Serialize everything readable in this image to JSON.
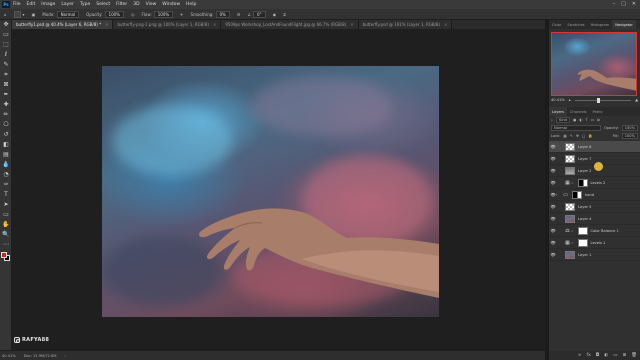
{
  "menu": {
    "logo": "Ps",
    "items": [
      "File",
      "Edit",
      "Image",
      "Layer",
      "Type",
      "Select",
      "Filter",
      "3D",
      "View",
      "Window",
      "Help"
    ],
    "window_controls": [
      "–",
      "□",
      "✕"
    ]
  },
  "options": {
    "mode_label": "Mode:",
    "mode_value": "Normal",
    "opacity_label": "Opacity:",
    "opacity_value": "100%",
    "flow_label": "Flow:",
    "flow_value": "100%",
    "smoothing_label": "Smoothing:",
    "smoothing_value": "0%",
    "angle_value": "0°"
  },
  "tabs": [
    {
      "label": "butterfly1.psd @ 40.4% (Layer 6, RGB/8) *",
      "active": true
    },
    {
      "label": "butterfly-png-1.png @ 100% (Layer 1, RGB/8)",
      "active": false
    },
    {
      "label": "9509ps Workshop_LostAndFoundFlight.jpg @ 66.7% (RGB/8)",
      "active": false
    },
    {
      "label": "butterfly.psd @ 191% (Layer 1, RGB/8)",
      "active": false
    }
  ],
  "status": {
    "zoom": "40.41%",
    "doc": "Doc: 15.9M/72.6M"
  },
  "watermark": "RAFYA88",
  "panel_tabs": [
    "Color",
    "Swatches",
    "Histogram",
    "Navigator"
  ],
  "active_panel_tab": "Navigator",
  "navigator": {
    "zoom": "40.41%"
  },
  "layers_panel": {
    "tabs": [
      "Layers",
      "Channels",
      "Paths"
    ],
    "kind_label": "Kind",
    "blend_mode": "Normal",
    "opacity_label": "Opacity:",
    "opacity_value": "100%",
    "lock_label": "Lock:",
    "fill_label": "Fill:",
    "fill_value": "100%"
  },
  "layers": [
    {
      "name": "Layer 6",
      "thumb": "check",
      "selected": true,
      "type": "pixel"
    },
    {
      "name": "Layer 7",
      "thumb": "check",
      "selected": false,
      "type": "pixel"
    },
    {
      "name": "Layer 2",
      "thumb": "grey",
      "selected": false,
      "type": "pixel"
    },
    {
      "name": "Levels 2",
      "thumb": "blackwhite",
      "selected": false,
      "type": "adjustment",
      "adj_icon": "▦"
    },
    {
      "name": "hand",
      "thumb": "blackwhite",
      "selected": false,
      "type": "group"
    },
    {
      "name": "Layer 5",
      "thumb": "check",
      "selected": false,
      "type": "pixel"
    },
    {
      "name": "Layer 4",
      "thumb": "sky",
      "selected": false,
      "type": "pixel"
    },
    {
      "name": "Color Balance 1",
      "thumb": "white",
      "selected": false,
      "type": "adjustment",
      "adj_icon": "⚖"
    },
    {
      "name": "Levels 1",
      "thumb": "white",
      "selected": false,
      "type": "adjustment",
      "adj_icon": "▦"
    },
    {
      "name": "Layer 1",
      "thumb": "sky",
      "selected": false,
      "type": "pixel"
    }
  ],
  "layer_footer_icons": [
    "link-icon",
    "fx-icon",
    "mask-icon",
    "adjustment-icon",
    "folder-icon",
    "new-layer-icon",
    "trash-icon"
  ],
  "layer_footer_glyphs": [
    "∞",
    "fx",
    "◘",
    "◐",
    "▭",
    "⊞",
    "🗑"
  ],
  "colors": {
    "foreground": "#c8261f",
    "background": "#000000",
    "accent": "#31a8ff"
  },
  "tools": [
    "move-tool-icon",
    "artboard-icon",
    "marquee-tool-icon",
    "lasso-tool-icon",
    "quick-select-icon",
    "crop-tool-icon",
    "frame-tool-icon",
    "eyedropper-icon",
    "healing-brush-icon",
    "brush-tool-icon",
    "clone-stamp-icon",
    "history-brush-icon",
    "eraser-tool-icon",
    "gradient-tool-icon",
    "blur-tool-icon",
    "dodge-tool-icon",
    "pen-tool-icon",
    "type-tool-icon",
    "path-select-icon",
    "rectangle-tool-icon",
    "hand-tool-icon",
    "zoom-tool-icon",
    "more-tools-icon"
  ],
  "tool_glyphs": [
    "✥",
    "▭",
    "⬚",
    "ℓ",
    "✎",
    "⌗",
    "⊠",
    "✒",
    "✚",
    "✏",
    "⎔",
    "↺",
    "◧",
    "▤",
    "💧",
    "◔",
    "✑",
    "T",
    "➤",
    "▭",
    "✋",
    "🔍",
    "⋯"
  ]
}
